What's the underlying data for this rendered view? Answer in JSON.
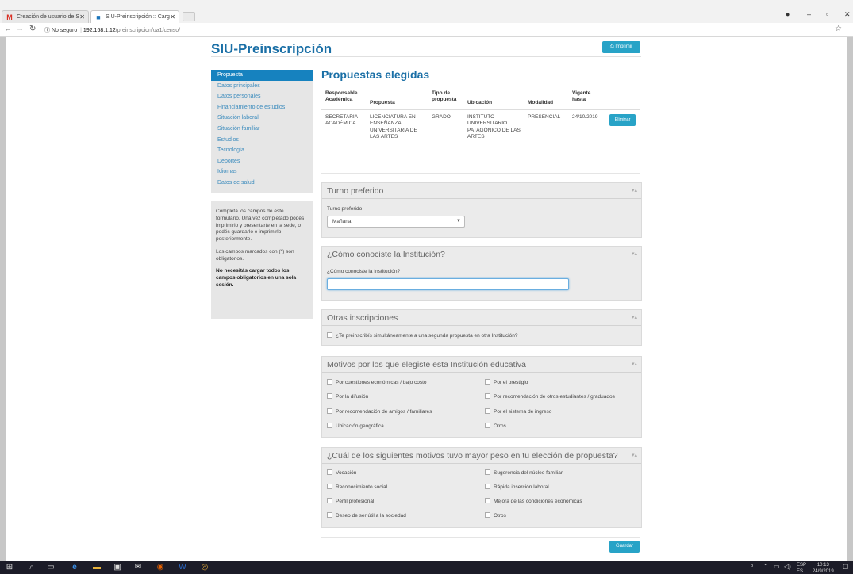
{
  "browser": {
    "tabs": [
      {
        "label": "Creación de usuario de S",
        "icon": "gmail-icon"
      },
      {
        "label": "SIU-Preinscripción :: Carg",
        "icon": "siu-icon"
      }
    ],
    "url_insecure": "No seguro",
    "url_host": "192.168.1.12",
    "url_path": "/preinscripcion/ua1/censo/"
  },
  "header": {
    "title": "SIU-Preinscripción",
    "print_label": "Imprimir"
  },
  "sidebar": {
    "items": [
      {
        "label": "Propuesta"
      },
      {
        "label": "Datos principales"
      },
      {
        "label": "Datos personales"
      },
      {
        "label": "Financiamiento de estudios"
      },
      {
        "label": "Situación laboral"
      },
      {
        "label": "Situación familiar"
      },
      {
        "label": "Estudios"
      },
      {
        "label": "Tecnología"
      },
      {
        "label": "Deportes"
      },
      {
        "label": "Idiomas"
      },
      {
        "label": "Datos de salud"
      }
    ],
    "info": {
      "p1": "Completá los campos de este formulario. Una vez completado podés imprimirlo y presentarte en la sede, o podés guardarlo e imprimirlo posteriormente.",
      "p2": "Los campos marcados con (*) son obligatorios.",
      "p3": "No necesitás cargar todos los campos obligatorios en una sola sesión."
    }
  },
  "proposals": {
    "heading": "Propuestas elegidas",
    "columns": [
      "Responsable Académica",
      "Propuesta",
      "Tipo de propuesta",
      "Ubicación",
      "Modalidad",
      "Vigente hasta"
    ],
    "row": {
      "responsable": "SECRETARIA ACADÉMICA",
      "propuesta": "LICENCIATURA EN ENSEÑANZA UNIVERSITARIA DE LAS ARTES",
      "tipo": "GRADO",
      "ubicacion": "INSTITUTO UNIVERSITARIO PATAGÓNICO DE LAS ARTES",
      "modalidad": "PRESENCIAL",
      "vigente": "24/10/2019",
      "remove_label": "Eliminar"
    }
  },
  "turno": {
    "title": "Turno preferido",
    "field_label": "Turno preferido",
    "selected": "Mañana"
  },
  "conociste": {
    "title": "¿Cómo conociste la Institución?",
    "field_label": "¿Cómo conociste la Institución?",
    "value": ""
  },
  "otras": {
    "title": "Otras inscripciones",
    "checkbox_label": "¿Te preinscribís simultáneamente a una segunda propuesta en otra Institución?"
  },
  "motivos": {
    "title": "Motivos por los que elegiste esta Institución educativa",
    "left": [
      "Por cuestiones económicas / bajo costo",
      "Por la difusión",
      "Por recomendación de amigos / familiares",
      "Ubicación geográfica"
    ],
    "right": [
      "Por el prestigio",
      "Por recomendación de otros estudiantes / graduados",
      "Por el sistema de ingreso",
      "Otros"
    ]
  },
  "peso": {
    "title": "¿Cuál de los siguientes motivos tuvo mayor peso en tu elección de propuesta?",
    "left": [
      "Vocación",
      "Reconocimiento social",
      "Perfil profesional",
      "Deseo de ser útil a la sociedad"
    ],
    "right": [
      "Sugerencia del núcleo familiar",
      "Rápida inserción laboral",
      "Mejora de las condiciones económicas",
      "Otros"
    ]
  },
  "footer": {
    "save_label": "Guardar"
  },
  "taskbar": {
    "lang": "ESP",
    "lang_sub": "ES",
    "time": "10:13",
    "date": "24/9/2019"
  }
}
